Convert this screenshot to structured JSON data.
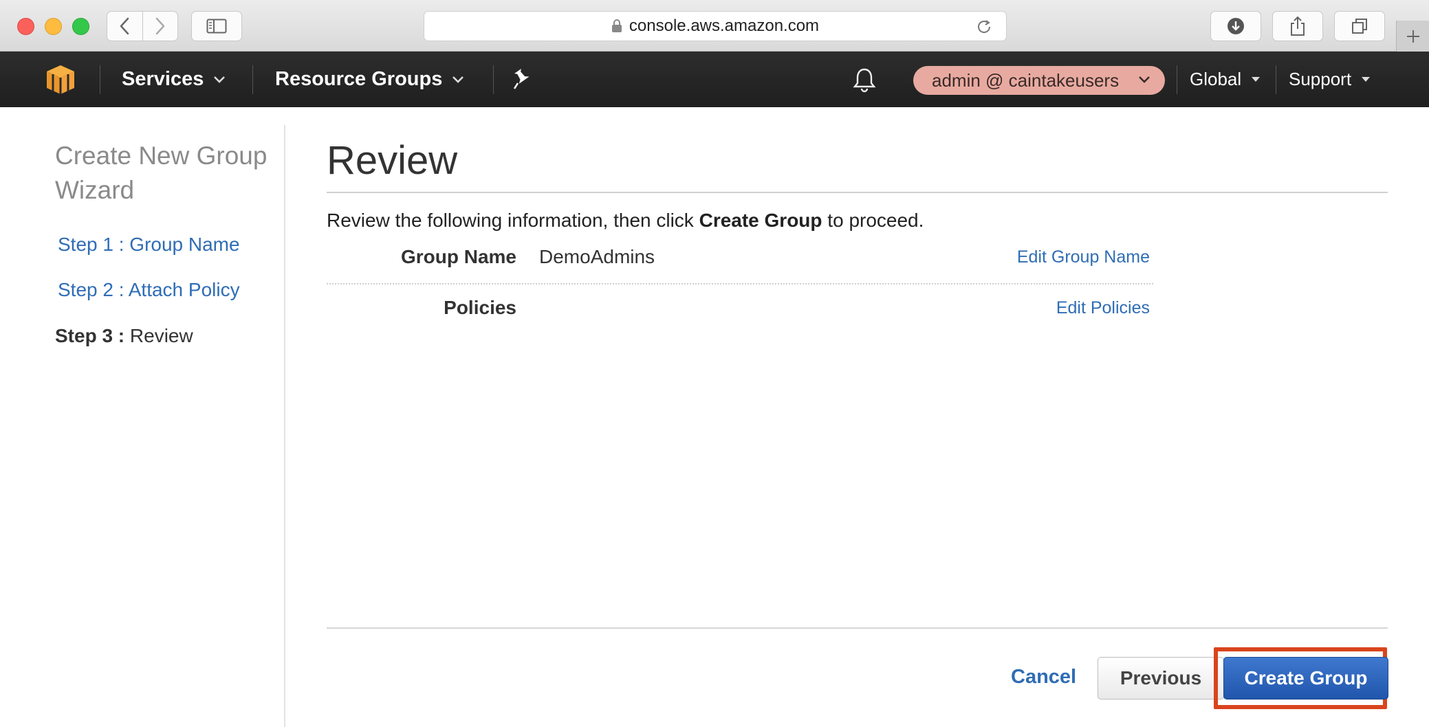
{
  "browser": {
    "url": "console.aws.amazon.com"
  },
  "aws_nav": {
    "services_label": "Services",
    "resource_groups_label": "Resource Groups",
    "account_label": "admin @ caintakeusers",
    "region_label": "Global",
    "support_label": "Support"
  },
  "wizard": {
    "title": "Create New Group Wizard",
    "steps": [
      {
        "label": "Step 1 : Group Name",
        "state": "link"
      },
      {
        "label": "Step 2 : Attach Policy",
        "state": "link"
      },
      {
        "prefix": "Step 3 :",
        "label": "Review",
        "state": "current"
      }
    ]
  },
  "review": {
    "title": "Review",
    "instruction_pre": "Review the following information, then click ",
    "instruction_bold": "Create Group",
    "instruction_post": " to proceed.",
    "rows": [
      {
        "label": "Group Name",
        "value": "DemoAdmins",
        "edit_label": "Edit Group Name"
      },
      {
        "label": "Policies",
        "value": "",
        "edit_label": "Edit Policies"
      }
    ]
  },
  "footer": {
    "cancel_label": "Cancel",
    "previous_label": "Previous",
    "create_label": "Create Group"
  },
  "colors": {
    "nav_bg": "#232323",
    "link": "#2f6db5",
    "primary_button": "#2f63bd",
    "highlight": "#d9441c",
    "account_pill": "#e8aaa0"
  },
  "icons": [
    "back-icon",
    "forward-icon",
    "sidebar-icon",
    "lock-icon",
    "reload-icon",
    "download-icon",
    "share-icon",
    "tabs-icon",
    "plus-icon",
    "aws-cube-icon",
    "pin-icon",
    "bell-icon",
    "chevron-down-icon"
  ]
}
